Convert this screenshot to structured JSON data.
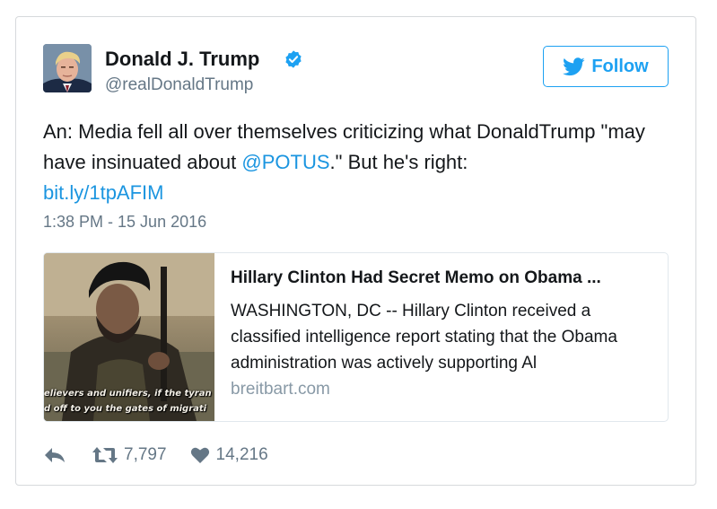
{
  "user": {
    "name": "Donald J. Trump",
    "handle": "@realDonaldTrump",
    "verified_icon": "verified-badge-icon"
  },
  "follow_button": {
    "label": "Follow",
    "icon": "twitter-bird-icon"
  },
  "tweet": {
    "text_part1": "An: Media fell all over themselves criticizing what DonaldTrump \"may have insinuated about ",
    "mention": "@POTUS",
    "text_part2": ".\" But he's right: ",
    "link": "bit.ly/1tpAFIM",
    "timestamp": "1:38 PM - 15 Jun 2016"
  },
  "card": {
    "image_caption_line1": "elievers and unifiers, if the tyran",
    "image_caption_line2": "d off to you the gates of migrati",
    "title": "Hillary Clinton Had Secret Memo on Obama ...",
    "description": "WASHINGTON, DC -- Hillary Clinton received a classified intelligence report stating that the Obama administration was actively supporting Al",
    "domain": "breitbart.com"
  },
  "actions": {
    "reply_icon": "reply-icon",
    "retweet_icon": "retweet-icon",
    "retweet_count": "7,797",
    "like_icon": "heart-icon",
    "like_count": "14,216"
  },
  "colors": {
    "link_blue": "#1b95e0",
    "follow_blue": "#1da1f2",
    "muted_gray": "#657786",
    "border": "#e1e8ed"
  }
}
